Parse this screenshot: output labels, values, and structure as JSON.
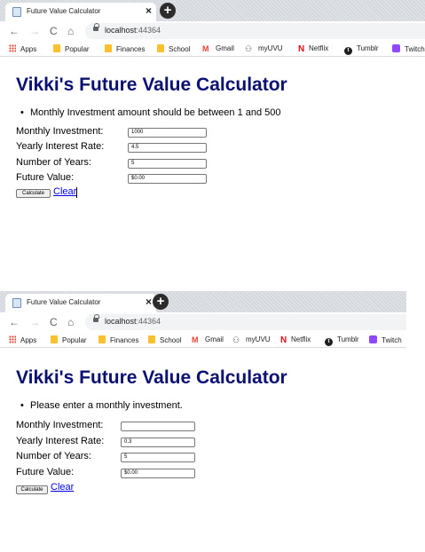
{
  "screens": [
    {
      "tab_title": "Future Value Calculator",
      "url_host": "localhost",
      "url_port": ":44364",
      "bookmarks": [
        {
          "label": "Apps",
          "icon": "apps-icon"
        },
        {
          "label": "Popular",
          "icon": "folder-icon"
        },
        {
          "label": "Finances",
          "icon": "folder-icon"
        },
        {
          "label": "School",
          "icon": "folder-icon"
        },
        {
          "label": "Gmail",
          "icon": "gmail-icon"
        },
        {
          "label": "myUVU",
          "icon": "people-icon"
        },
        {
          "label": "Netflix",
          "icon": "netflix-icon"
        },
        {
          "label": "Tumblr",
          "icon": "tumblr-icon"
        },
        {
          "label": "Twitch",
          "icon": "twitch-icon"
        }
      ],
      "page_title": "Vikki's Future Value Calculator",
      "validation_message": "Monthly Investment amount should be between 1 and 500",
      "labels": {
        "monthly": "Monthly Investment:",
        "rate": "Yearly Interest Rate:",
        "years": "Number of Years:",
        "future": "Future Value:"
      },
      "values": {
        "monthly": "1000",
        "rate": "4.5",
        "years": "5",
        "future": "$0.00"
      },
      "calculate_label": "Calculate",
      "clear_label": "Clear"
    },
    {
      "tab_title": "Future Value Calculator",
      "url_host": "localhost",
      "url_port": ":44364",
      "bookmarks": [
        {
          "label": "Apps",
          "icon": "apps-icon"
        },
        {
          "label": "Popular",
          "icon": "folder-icon"
        },
        {
          "label": "Finances",
          "icon": "folder-icon"
        },
        {
          "label": "School",
          "icon": "folder-icon"
        },
        {
          "label": "Gmail",
          "icon": "gmail-icon"
        },
        {
          "label": "myUVU",
          "icon": "people-icon"
        },
        {
          "label": "Netflix",
          "icon": "netflix-icon"
        },
        {
          "label": "Tumblr",
          "icon": "tumblr-icon"
        },
        {
          "label": "Twitch",
          "icon": "twitch-icon"
        }
      ],
      "page_title": "Vikki's Future Value Calculator",
      "validation_message": "Please enter a monthly investment.",
      "labels": {
        "monthly": "Monthly Investment:",
        "rate": "Yearly Interest Rate:",
        "years": "Number of Years:",
        "future": "Future Value:"
      },
      "values": {
        "monthly": "",
        "rate": "0.3",
        "years": "5",
        "future": "$0.00"
      },
      "calculate_label": "Calculate",
      "clear_label": "Clear"
    }
  ]
}
